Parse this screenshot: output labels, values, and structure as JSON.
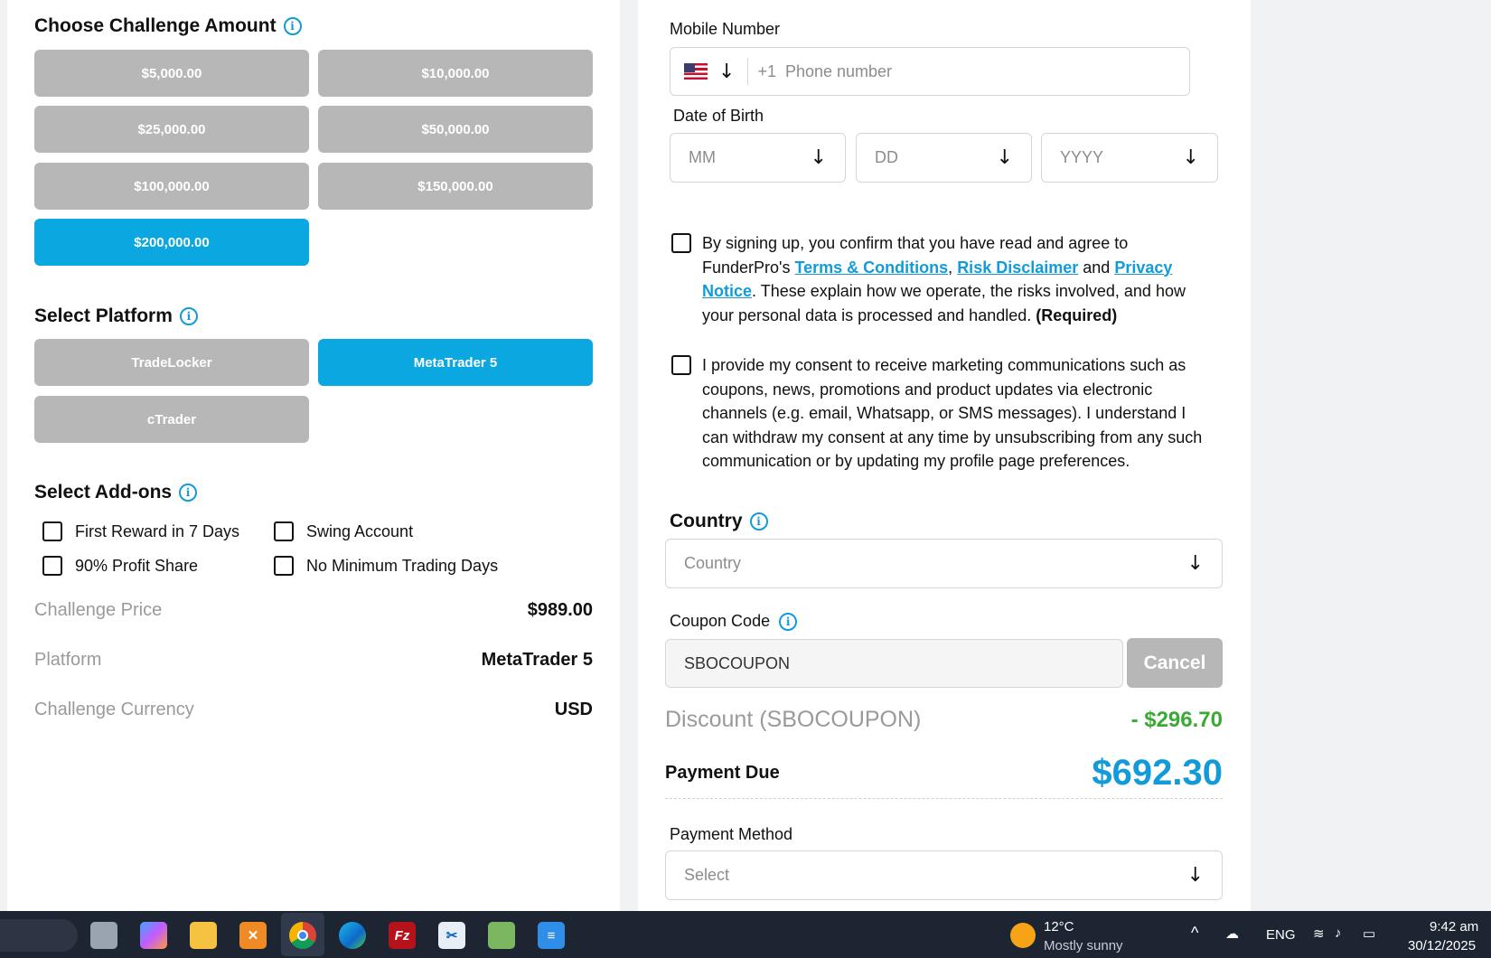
{
  "challenge": {
    "title": "Choose Challenge Amount",
    "amounts": [
      "$5,000.00",
      "$10,000.00",
      "$25,000.00",
      "$50,000.00",
      "$100,000.00",
      "$150,000.00",
      "$200,000.00"
    ],
    "selected": "$200,000.00"
  },
  "platform": {
    "title": "Select Platform",
    "options": [
      "TradeLocker",
      "MetaTrader 5",
      "cTrader"
    ],
    "selected": "MetaTrader 5"
  },
  "addons": {
    "title": "Select Add-ons",
    "items": [
      "First Reward in 7 Days",
      "Swing Account",
      "90% Profit Share",
      "No Minimum Trading Days"
    ]
  },
  "summary": {
    "price_label": "Challenge Price",
    "price_value": "$989.00",
    "platform_label": "Platform",
    "platform_value": "MetaTrader 5",
    "currency_label": "Challenge Currency",
    "currency_value": "USD"
  },
  "form": {
    "mobile_label": "Mobile Number",
    "dial_code": "+1",
    "phone_placeholder": "Phone number",
    "dob_label": "Date of Birth",
    "dob_mm": "MM",
    "dob_dd": "DD",
    "dob_yyyy": "YYYY",
    "consent1_pre": "By signing up, you confirm that you have read and agree to FunderPro's ",
    "consent1_link1": "Terms & Conditions",
    "consent1_sep": ", ",
    "consent1_link2": "Risk Disclaimer",
    "consent1_and": " and ",
    "consent1_link3": "Privacy Notice",
    "consent1_post": ". These explain how we operate, the risks involved, and how your personal data is processed and handled. ",
    "consent1_required": "(Required)",
    "consent2": "I provide my consent to receive marketing communications such as coupons, news, promotions and product updates via electronic channels (e.g. email, Whatsapp, or SMS messages). I understand I can withdraw my consent at any time by unsubscribing from any such communication or by updating my profile page preferences.",
    "country_label": "Country",
    "country_placeholder": "Country",
    "coupon_label": "Coupon Code",
    "coupon_value": "SBOCOUPON",
    "cancel_label": "Cancel",
    "discount_label": "Discount (SBOCOUPON)",
    "discount_value": "- $296.70",
    "payment_due_label": "Payment Due",
    "payment_due_value": "$692.30",
    "payment_method_label": "Payment Method",
    "payment_method_placeholder": "Select"
  },
  "taskbar": {
    "weather_temp": "12°C",
    "weather_desc": "Mostly sunny",
    "language": "ENG",
    "time": "9:42 am",
    "date": "30/12/2025"
  },
  "colors": {
    "accent": "#0aa7e0",
    "unselected": "#b7b7b7",
    "discount": "#3aaa35",
    "payment_due": "#129bd8"
  }
}
